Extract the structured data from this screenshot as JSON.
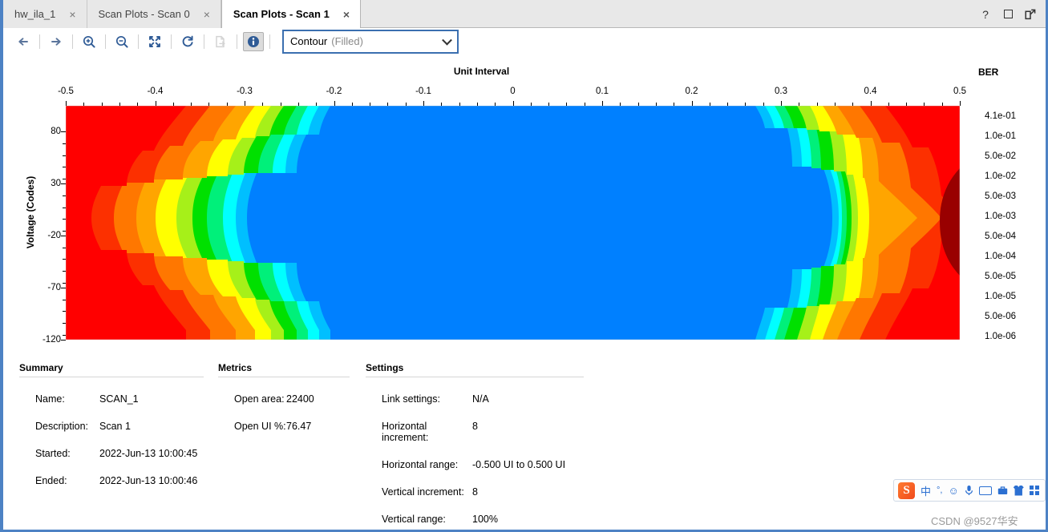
{
  "window": {
    "help_icon": "?",
    "restore_icon": "square",
    "popout_icon": "external-link"
  },
  "tabs": [
    {
      "label": "hw_ila_1",
      "close": "×",
      "active": false
    },
    {
      "label": "Scan Plots - Scan 0",
      "close": "×",
      "active": false
    },
    {
      "label": "Scan Plots - Scan 1",
      "close": "×",
      "active": true
    }
  ],
  "toolbar": {
    "buttons": [
      {
        "name": "back-icon",
        "label": "Back",
        "enabled": true
      },
      {
        "name": "forward-icon",
        "label": "Forward",
        "enabled": true
      },
      {
        "name": "zoom-in-icon",
        "label": "Zoom In",
        "enabled": true
      },
      {
        "name": "zoom-out-icon",
        "label": "Zoom Out",
        "enabled": true
      },
      {
        "name": "zoom-fit-icon",
        "label": "Zoom Fit",
        "enabled": true
      },
      {
        "name": "refresh-icon",
        "label": "Refresh",
        "enabled": true
      },
      {
        "name": "export-icon",
        "label": "Export",
        "enabled": false
      },
      {
        "name": "info-icon",
        "label": "Show Info",
        "enabled": true
      }
    ],
    "plot_type": "Contour",
    "plot_type_sub": "(Filled)"
  },
  "chart_data": {
    "type": "heatmap",
    "title": "Unit Interval",
    "xlabel": "Unit Interval",
    "ylabel": "Voltage (Codes)",
    "legend_title": "BER",
    "legend_position": "right",
    "grid": false,
    "xlim": [
      -0.5,
      0.5
    ],
    "ylim": [
      -120,
      105
    ],
    "xticks": [
      -0.5,
      -0.4,
      -0.3,
      -0.2,
      -0.1,
      0,
      0.1,
      0.2,
      0.3,
      0.4,
      0.5
    ],
    "xticklabels": [
      "-0.5",
      "-0.4",
      "-0.3",
      "-0.2",
      "-0.1",
      "0",
      "0.1",
      "0.2",
      "0.3",
      "0.4",
      "0.5"
    ],
    "yticks": [
      80,
      30,
      -20,
      -70,
      -120
    ],
    "yticklabels": [
      "80",
      "30",
      "-20",
      "-70",
      "-120"
    ],
    "colorbar_levels": [
      {
        "label": "4.1e-01",
        "value": 0.41,
        "color": "#990000"
      },
      {
        "label": "1.0e-01",
        "value": 0.1,
        "color": "#ff0000"
      },
      {
        "label": "5.0e-02",
        "value": 0.05,
        "color": "#fc3000"
      },
      {
        "label": "1.0e-02",
        "value": 0.01,
        "color": "#ff7700"
      },
      {
        "label": "5.0e-03",
        "value": 0.005,
        "color": "#ffa500"
      },
      {
        "label": "1.0e-03",
        "value": 0.001,
        "color": "#ffff00"
      },
      {
        "label": "5.0e-04",
        "value": 0.0005,
        "color": "#a6f019"
      },
      {
        "label": "1.0e-04",
        "value": 0.0001,
        "color": "#00e000"
      },
      {
        "label": "5.0e-05",
        "value": 5e-05,
        "color": "#00f07a"
      },
      {
        "label": "1.0e-05",
        "value": 1e-05,
        "color": "#00ffff"
      },
      {
        "label": "5.0e-06",
        "value": 5e-06,
        "color": "#00bfff"
      },
      {
        "label": "1.0e-06",
        "value": 1e-06,
        "color": "#0080ff"
      }
    ],
    "description": "Eye diagram BER contour scan: open blue eye (BER 1.0e-06) spans roughly -0.25 UI to 0.30 UI, with stepped transition bands of cyan/green/yellow/orange and saturated red closed regions at both horizontal extremes; a dark red (4.1e-01) lobe appears near 0.47 UI."
  },
  "summary": {
    "heading": "Summary",
    "rows": [
      {
        "key": "Name:",
        "value": "SCAN_1"
      },
      {
        "key": "Description:",
        "value": "Scan 1"
      },
      {
        "key": "Started:",
        "value": "2022-Jun-13 10:00:45"
      },
      {
        "key": "Ended:",
        "value": "2022-Jun-13 10:00:46"
      }
    ]
  },
  "metrics": {
    "heading": "Metrics",
    "rows": [
      {
        "key": "Open area:",
        "value": "22400"
      },
      {
        "key": "Open UI %:",
        "value": "76.47"
      }
    ]
  },
  "settings": {
    "heading": "Settings",
    "rows": [
      {
        "key": "Link settings:",
        "value": "N/A"
      },
      {
        "key": "Horizontal increment:",
        "value": "8"
      },
      {
        "key": "Horizontal range:",
        "value": "-0.500 UI to 0.500 UI"
      },
      {
        "key": "Vertical increment:",
        "value": "8"
      },
      {
        "key": "Vertical range:",
        "value": "100%"
      }
    ]
  },
  "ime": {
    "logo": "S",
    "mode": "中",
    "punct": "°,",
    "emoji": "☺",
    "mic": "🎤",
    "keyboard": "keyboard-icon",
    "toolbox": "toolbox-icon",
    "skin": "skin-icon",
    "apps": "apps-icon"
  },
  "watermark": "CSDN @9527华安"
}
